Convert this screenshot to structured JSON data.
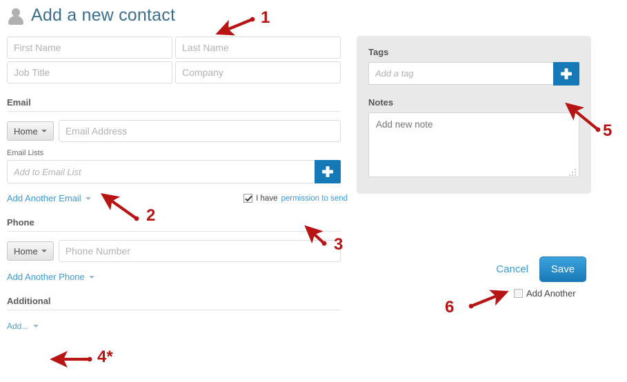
{
  "header": {
    "icon": "person-icon",
    "title": "Add a new contact"
  },
  "form": {
    "first_name": {
      "placeholder": "First Name",
      "value": ""
    },
    "last_name": {
      "placeholder": "Last Name",
      "value": ""
    },
    "job_title": {
      "placeholder": "Job Title",
      "value": ""
    },
    "company": {
      "placeholder": "Company",
      "value": ""
    }
  },
  "email_section": {
    "heading": "Email",
    "type_button": "Home",
    "address_placeholder": "Email Address",
    "address_value": "",
    "lists_label": "Email Lists",
    "lists_placeholder": "Add to Email List",
    "lists_value": "",
    "add_button_icon": "plus-icon",
    "add_another_link": "Add Another Email",
    "permission_prefix": "I have",
    "permission_link": "permission to send",
    "permission_checked": true
  },
  "phone_section": {
    "heading": "Phone",
    "type_button": "Home",
    "number_placeholder": "Phone Number",
    "number_value": "",
    "add_another_link": "Add Another Phone"
  },
  "additional_section": {
    "heading": "Additional",
    "add_link": "Add..."
  },
  "side_panel": {
    "tags_label": "Tags",
    "tag_placeholder": "Add a tag",
    "tag_value": "",
    "tag_add_icon": "plus-icon",
    "notes_label": "Notes",
    "notes_placeholder": "Add new note",
    "notes_value": "",
    "resize_handle_icon": "resize-grip-icon"
  },
  "actions": {
    "cancel_label": "Cancel",
    "save_label": "Save",
    "add_another_label": "Add Another",
    "add_another_checked": false
  },
  "annotations": {
    "arrow_color": "#b81414",
    "markers": [
      {
        "id": "1",
        "label": "1"
      },
      {
        "id": "2",
        "label": "2"
      },
      {
        "id": "3",
        "label": "3"
      },
      {
        "id": "4",
        "label": "4*"
      },
      {
        "id": "5",
        "label": "5"
      },
      {
        "id": "6",
        "label": "6"
      }
    ]
  },
  "colors": {
    "accent_blue": "#1579b8",
    "link_blue": "#3a9ad9",
    "title_blue": "#3b6e8f",
    "panel_gray": "#e9e9e9",
    "annotation_red": "#b81414"
  }
}
